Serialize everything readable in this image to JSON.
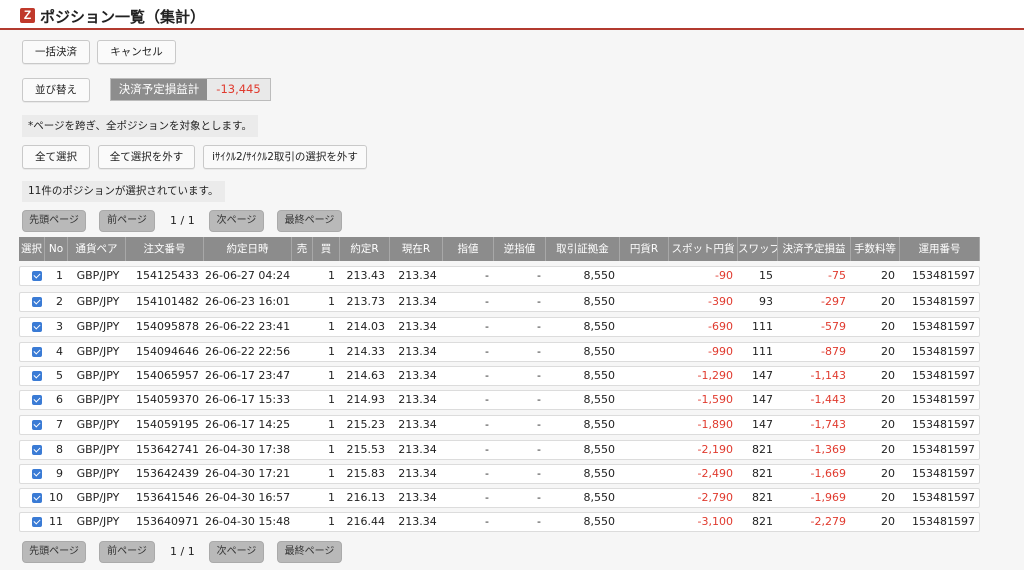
{
  "header": {
    "logo": "Z",
    "title": "ポジション一覧（集計）"
  },
  "actions": {
    "bulk_settle": "一括決済",
    "cancel": "キャンセル",
    "sort": "並び替え"
  },
  "pnl": {
    "label": "決済予定損益計",
    "value": "-13,445"
  },
  "note": "*ページを跨ぎ、全ポジションを対象とします。",
  "selection": {
    "select_all": "全て選択",
    "deselect_all": "全て選択を外す",
    "deselect_cycle": "iｻｲｸﾙ2/ｻｲｸﾙ2取引の選択を外す"
  },
  "selected_count": "11件のポジションが選択されています。",
  "pager": {
    "first": "先頭ページ",
    "prev": "前ページ",
    "page": "1 / 1",
    "next": "次ページ",
    "last": "最終ページ"
  },
  "table": {
    "columns": [
      "選択",
      "No",
      "通貨ペア",
      "注文番号",
      "約定日時",
      "売",
      "買",
      "約定R",
      "現在R",
      "指値",
      "逆指値",
      "取引証拠金",
      "円貨R",
      "スポット円貨",
      "スワップ",
      "決済予定損益",
      "手数料等",
      "運用番号"
    ],
    "rows": [
      {
        "no": "1",
        "pair": "GBP/JPY",
        "order": "154125433",
        "datetime": "26-06-27 04:24",
        "sell": "",
        "buy": "1",
        "exec_rate": "213.43",
        "cur_rate": "213.34",
        "limit": "-",
        "stop": "-",
        "margin": "8,550",
        "yen_rate": "",
        "spot": "-90",
        "swap": "15",
        "pnl": "-75",
        "fee": "20",
        "account": "153481597"
      },
      {
        "no": "2",
        "pair": "GBP/JPY",
        "order": "154101482",
        "datetime": "26-06-23 16:01",
        "sell": "",
        "buy": "1",
        "exec_rate": "213.73",
        "cur_rate": "213.34",
        "limit": "-",
        "stop": "-",
        "margin": "8,550",
        "yen_rate": "",
        "spot": "-390",
        "swap": "93",
        "pnl": "-297",
        "fee": "20",
        "account": "153481597"
      },
      {
        "no": "3",
        "pair": "GBP/JPY",
        "order": "154095878",
        "datetime": "26-06-22 23:41",
        "sell": "",
        "buy": "1",
        "exec_rate": "214.03",
        "cur_rate": "213.34",
        "limit": "-",
        "stop": "-",
        "margin": "8,550",
        "yen_rate": "",
        "spot": "-690",
        "swap": "111",
        "pnl": "-579",
        "fee": "20",
        "account": "153481597"
      },
      {
        "no": "4",
        "pair": "GBP/JPY",
        "order": "154094646",
        "datetime": "26-06-22 22:56",
        "sell": "",
        "buy": "1",
        "exec_rate": "214.33",
        "cur_rate": "213.34",
        "limit": "-",
        "stop": "-",
        "margin": "8,550",
        "yen_rate": "",
        "spot": "-990",
        "swap": "111",
        "pnl": "-879",
        "fee": "20",
        "account": "153481597"
      },
      {
        "no": "5",
        "pair": "GBP/JPY",
        "order": "154065957",
        "datetime": "26-06-17 23:47",
        "sell": "",
        "buy": "1",
        "exec_rate": "214.63",
        "cur_rate": "213.34",
        "limit": "-",
        "stop": "-",
        "margin": "8,550",
        "yen_rate": "",
        "spot": "-1,290",
        "swap": "147",
        "pnl": "-1,143",
        "fee": "20",
        "account": "153481597"
      },
      {
        "no": "6",
        "pair": "GBP/JPY",
        "order": "154059370",
        "datetime": "26-06-17 15:33",
        "sell": "",
        "buy": "1",
        "exec_rate": "214.93",
        "cur_rate": "213.34",
        "limit": "-",
        "stop": "-",
        "margin": "8,550",
        "yen_rate": "",
        "spot": "-1,590",
        "swap": "147",
        "pnl": "-1,443",
        "fee": "20",
        "account": "153481597"
      },
      {
        "no": "7",
        "pair": "GBP/JPY",
        "order": "154059195",
        "datetime": "26-06-17 14:25",
        "sell": "",
        "buy": "1",
        "exec_rate": "215.23",
        "cur_rate": "213.34",
        "limit": "-",
        "stop": "-",
        "margin": "8,550",
        "yen_rate": "",
        "spot": "-1,890",
        "swap": "147",
        "pnl": "-1,743",
        "fee": "20",
        "account": "153481597"
      },
      {
        "no": "8",
        "pair": "GBP/JPY",
        "order": "153642741",
        "datetime": "26-04-30 17:38",
        "sell": "",
        "buy": "1",
        "exec_rate": "215.53",
        "cur_rate": "213.34",
        "limit": "-",
        "stop": "-",
        "margin": "8,550",
        "yen_rate": "",
        "spot": "-2,190",
        "swap": "821",
        "pnl": "-1,369",
        "fee": "20",
        "account": "153481597"
      },
      {
        "no": "9",
        "pair": "GBP/JPY",
        "order": "153642439",
        "datetime": "26-04-30 17:21",
        "sell": "",
        "buy": "1",
        "exec_rate": "215.83",
        "cur_rate": "213.34",
        "limit": "-",
        "stop": "-",
        "margin": "8,550",
        "yen_rate": "",
        "spot": "-2,490",
        "swap": "821",
        "pnl": "-1,669",
        "fee": "20",
        "account": "153481597"
      },
      {
        "no": "10",
        "pair": "GBP/JPY",
        "order": "153641546",
        "datetime": "26-04-30 16:57",
        "sell": "",
        "buy": "1",
        "exec_rate": "216.13",
        "cur_rate": "213.34",
        "limit": "-",
        "stop": "-",
        "margin": "8,550",
        "yen_rate": "",
        "spot": "-2,790",
        "swap": "821",
        "pnl": "-1,969",
        "fee": "20",
        "account": "153481597"
      },
      {
        "no": "11",
        "pair": "GBP/JPY",
        "order": "153640971",
        "datetime": "26-04-30 15:48",
        "sell": "",
        "buy": "1",
        "exec_rate": "216.44",
        "cur_rate": "213.34",
        "limit": "-",
        "stop": "-",
        "margin": "8,550",
        "yen_rate": "",
        "spot": "-3,100",
        "swap": "821",
        "pnl": "-2,279",
        "fee": "20",
        "account": "153481597"
      }
    ]
  },
  "colors": {
    "accent": "#b23a2f",
    "negative": "#e03a2e",
    "header_gray": "#8c8c8c",
    "checkbox": "#3a7bd5"
  }
}
